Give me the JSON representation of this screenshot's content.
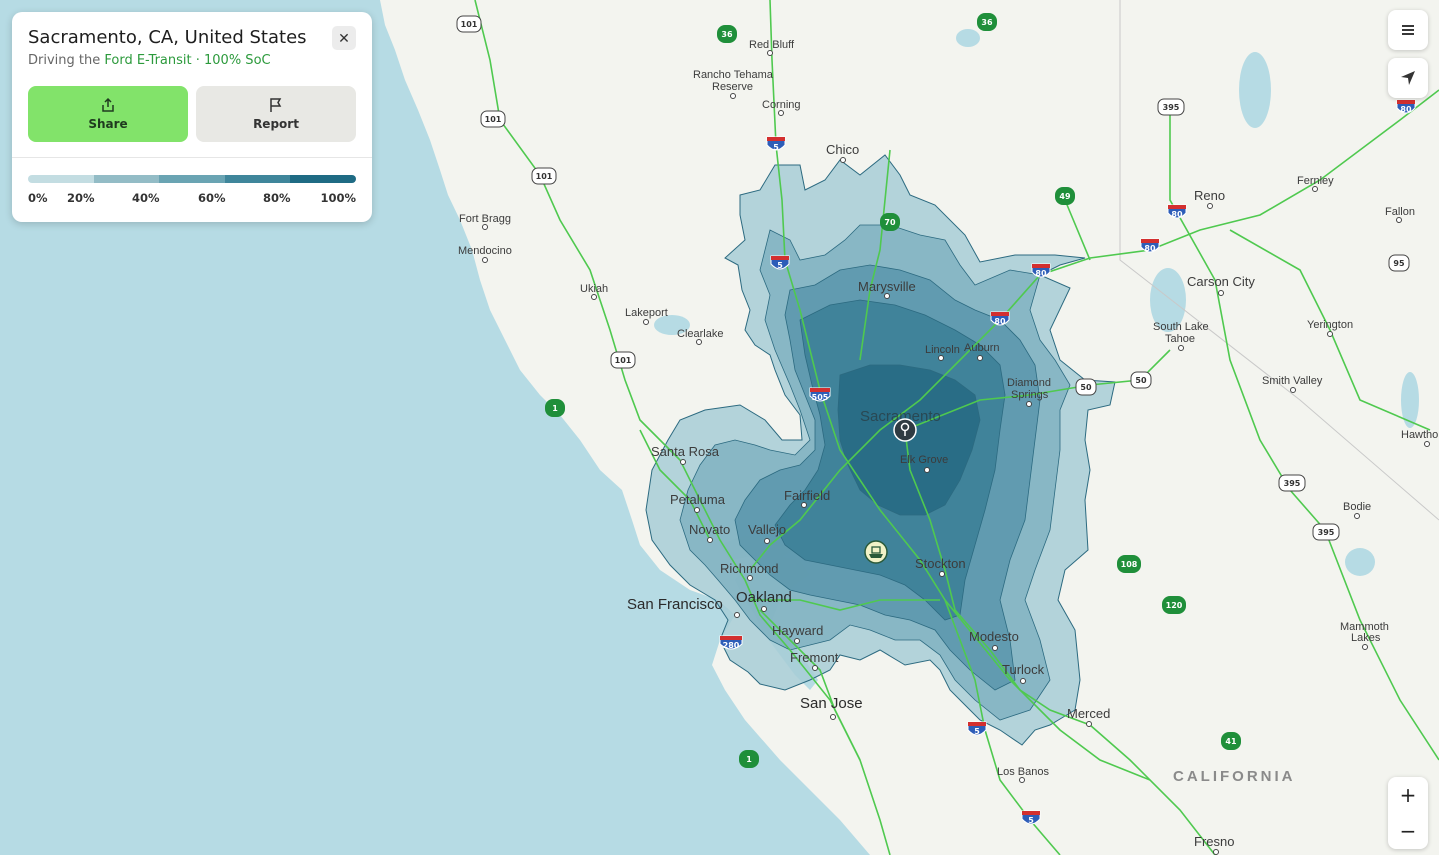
{
  "location_card": {
    "title": "Sacramento, CA, United States",
    "subtitle_prefix": "Driving the ",
    "vehicle": "Ford E-Transit · 100% SoC",
    "close_icon": "close-icon",
    "share_label": "Share",
    "share_icon": "share-icon",
    "report_label": "Report",
    "report_icon": "flag-icon"
  },
  "legend": {
    "labels": [
      "0%",
      "20%",
      "40%",
      "60%",
      "80%",
      "100%"
    ],
    "colors": [
      "#c3dde2",
      "#93bcc6",
      "#6aa4b3",
      "#3f869b",
      "#1f6b84"
    ]
  },
  "controls": {
    "menu_icon": "hamburger-menu-icon",
    "locate_icon": "navigation-arrow-icon",
    "zoom_in": "+",
    "zoom_out": "−"
  },
  "map": {
    "places": [
      {
        "name": "Red Bluff"
      },
      {
        "name": "Rancho Tehama"
      },
      {
        "name": "Reserve"
      },
      {
        "name": "Corning"
      },
      {
        "name": "Chico"
      },
      {
        "name": "Fort Bragg"
      },
      {
        "name": "Mendocino"
      },
      {
        "name": "Ukiah"
      },
      {
        "name": "Lakeport"
      },
      {
        "name": "Clearlake"
      },
      {
        "name": "Marysville"
      },
      {
        "name": "Lincoln"
      },
      {
        "name": "Auburn"
      },
      {
        "name": "Diamond"
      },
      {
        "name": "Springs"
      },
      {
        "name": "Sacramento"
      },
      {
        "name": "Elk Grove"
      },
      {
        "name": "Santa Rosa"
      },
      {
        "name": "Petaluma"
      },
      {
        "name": "Fairfield"
      },
      {
        "name": "Novato"
      },
      {
        "name": "Vallejo"
      },
      {
        "name": "Richmond"
      },
      {
        "name": "San Francisco"
      },
      {
        "name": "Oakland"
      },
      {
        "name": "Hayward"
      },
      {
        "name": "Fremont"
      },
      {
        "name": "San Jose"
      },
      {
        "name": "Stockton"
      },
      {
        "name": "Modesto"
      },
      {
        "name": "Turlock"
      },
      {
        "name": "Merced"
      },
      {
        "name": "Los Banos"
      },
      {
        "name": "Fresno"
      },
      {
        "name": "Reno"
      },
      {
        "name": "Fernley"
      },
      {
        "name": "Fallon"
      },
      {
        "name": "Carson City"
      },
      {
        "name": "South Lake"
      },
      {
        "name": "Tahoe"
      },
      {
        "name": "Yerington"
      },
      {
        "name": "Smith Valley"
      },
      {
        "name": "Hawthor"
      },
      {
        "name": "Bodie"
      },
      {
        "name": "Mammoth"
      },
      {
        "name": "Lakes"
      },
      {
        "name": "CALIFORNIA"
      }
    ],
    "shields": [
      "101",
      "36",
      "5",
      "101",
      "101",
      "70",
      "5",
      "1",
      "101",
      "80",
      "505",
      "50",
      "49",
      "80",
      "80",
      "395",
      "36",
      "80",
      "95",
      "395",
      "395",
      "108",
      "120",
      "41",
      "280",
      "5",
      "5",
      "1",
      "50",
      "80",
      "580"
    ]
  }
}
